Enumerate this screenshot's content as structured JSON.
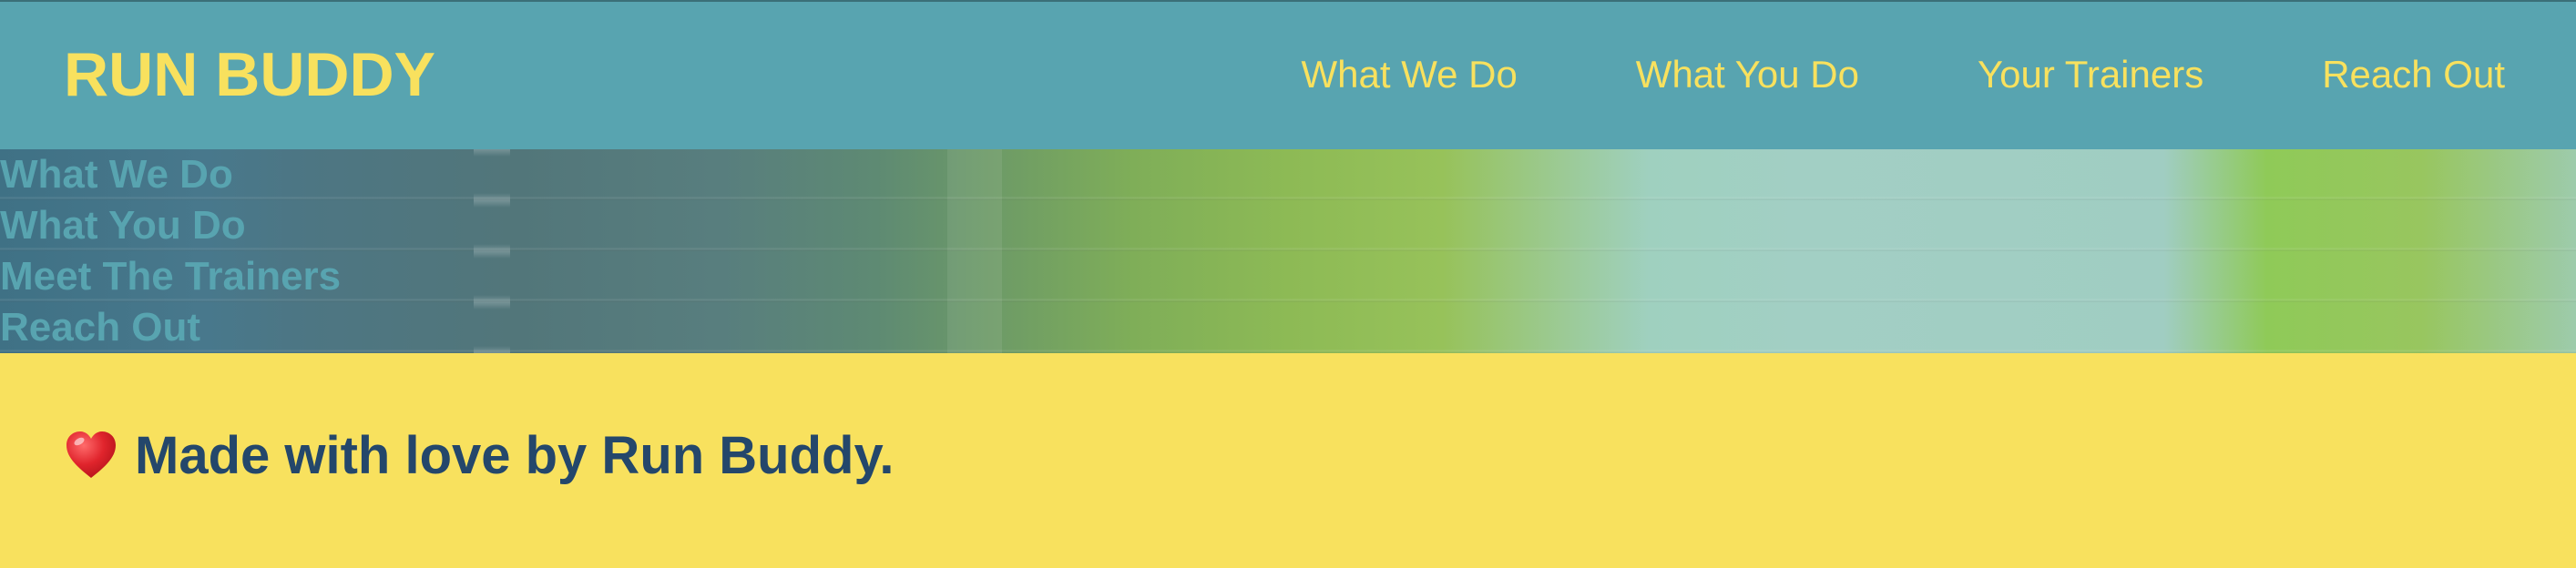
{
  "header": {
    "logo": "RUN BUDDY",
    "nav": [
      {
        "label": "What We Do"
      },
      {
        "label": "What You Do"
      },
      {
        "label": "Your Trainers"
      },
      {
        "label": "Reach Out"
      }
    ]
  },
  "hero": {
    "links": [
      {
        "label": "What We Do"
      },
      {
        "label": "What You Do"
      },
      {
        "label": "Meet The Trainers"
      },
      {
        "label": "Reach Out"
      }
    ]
  },
  "footer": {
    "icon": "heart-icon",
    "text": "Made with love by Run Buddy."
  },
  "colors": {
    "header_bg": "#58a4b0",
    "accent_yellow": "#f8e15e",
    "footer_text": "#24476b",
    "heart": "#e0242c"
  }
}
